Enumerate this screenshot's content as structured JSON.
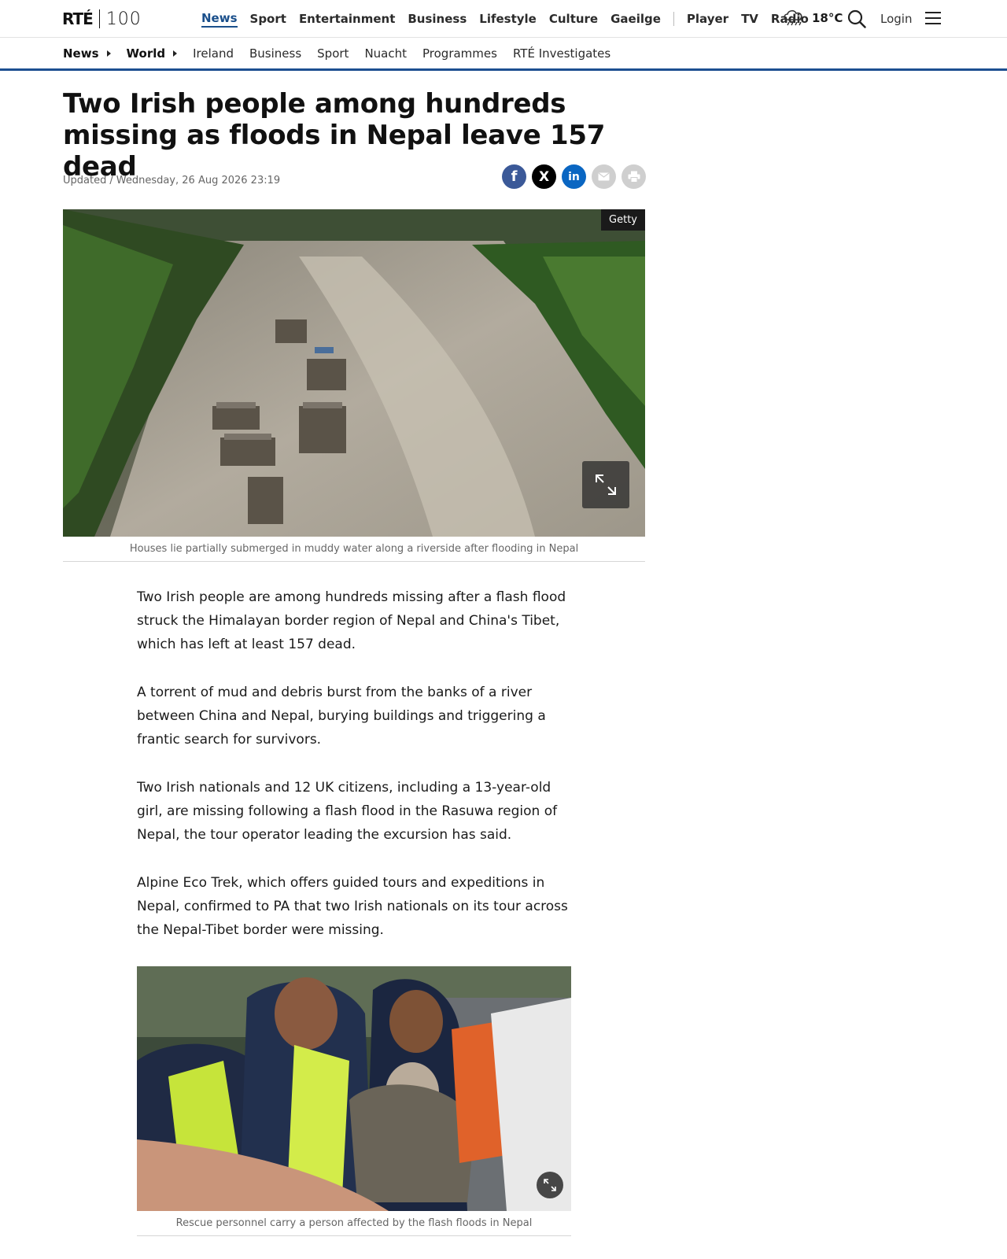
{
  "brand": {
    "name": "RTÉ",
    "suffix": "100"
  },
  "main_nav": {
    "items": [
      "News",
      "Sport",
      "Entertainment",
      "Business",
      "Lifestyle",
      "Culture",
      "Gaeilge"
    ],
    "media_items": [
      "Player",
      "TV",
      "Radio"
    ],
    "active": "News"
  },
  "weather": {
    "temperature": "18°C",
    "icon": "rain-cloud-icon"
  },
  "header_actions": {
    "login_label": "Login"
  },
  "sub_nav": {
    "items": [
      {
        "label": "News",
        "caret": true
      },
      {
        "label": "World",
        "caret": true
      },
      {
        "label": "Ireland",
        "caret": false
      },
      {
        "label": "Business",
        "caret": false
      },
      {
        "label": "Sport",
        "caret": false
      },
      {
        "label": "Nuacht",
        "caret": false
      },
      {
        "label": "Programmes",
        "caret": false
      },
      {
        "label": "RTÉ Investigates",
        "caret": false
      }
    ]
  },
  "article": {
    "headline": "Two Irish people among hundreds missing as floods in Nepal leave 157 dead",
    "updated_label": "Updated",
    "updated_time": "Wednesday, 26 Aug 2026 23:19",
    "hero_credit": "Getty",
    "hero_caption": "Houses lie partially submerged in muddy water along a riverside after flooding in Nepal",
    "paragraphs": [
      "Two Irish people are among hundreds missing after a flash flood struck the Himalayan border region of Nepal and China's Tibet, which has left at least 157 dead.",
      "A torrent of mud and debris burst from the banks of a river between China and Nepal, burying buildings and triggering a frantic search for survivors.",
      "Two Irish nationals and 12 UK citizens, including a 13-year-old girl, are missing following a flash flood in the Rasuwa region of Nepal, the tour operator leading the excursion has said.",
      "Alpine Eco Trek, which offers guided tours and expeditions in Nepal, confirmed to PA that two Irish nationals on its tour across the Nepal-Tibet border were missing."
    ],
    "inline_caption": "Rescue personnel carry a person affected by the flash floods in Nepal"
  },
  "share": {
    "facebook": "f",
    "x": "X",
    "linkedin": "in"
  },
  "colors": {
    "accent": "#1d4f91",
    "facebook": "#3b5998",
    "linkedin": "#0a66c2"
  }
}
